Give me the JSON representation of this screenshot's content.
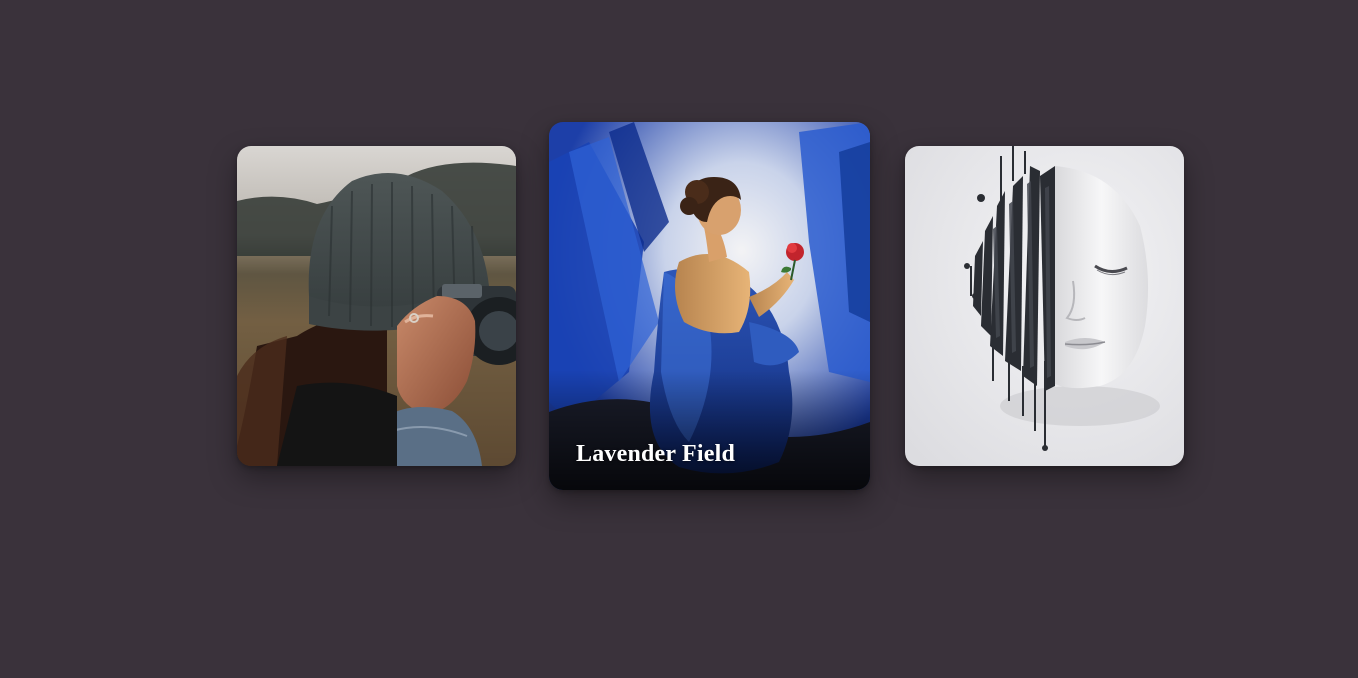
{
  "page": {
    "background_color": "#3a323b"
  },
  "gallery": {
    "cards": [
      {
        "id": "card-1",
        "caption": "",
        "image_icon": "photographer-image",
        "active": false
      },
      {
        "id": "card-2",
        "caption": "Lavender Field",
        "image_icon": "blue-dress-painting-image",
        "active": true
      },
      {
        "id": "card-3",
        "caption": "",
        "image_icon": "abstract-face-sculpture-image",
        "active": false
      }
    ]
  }
}
